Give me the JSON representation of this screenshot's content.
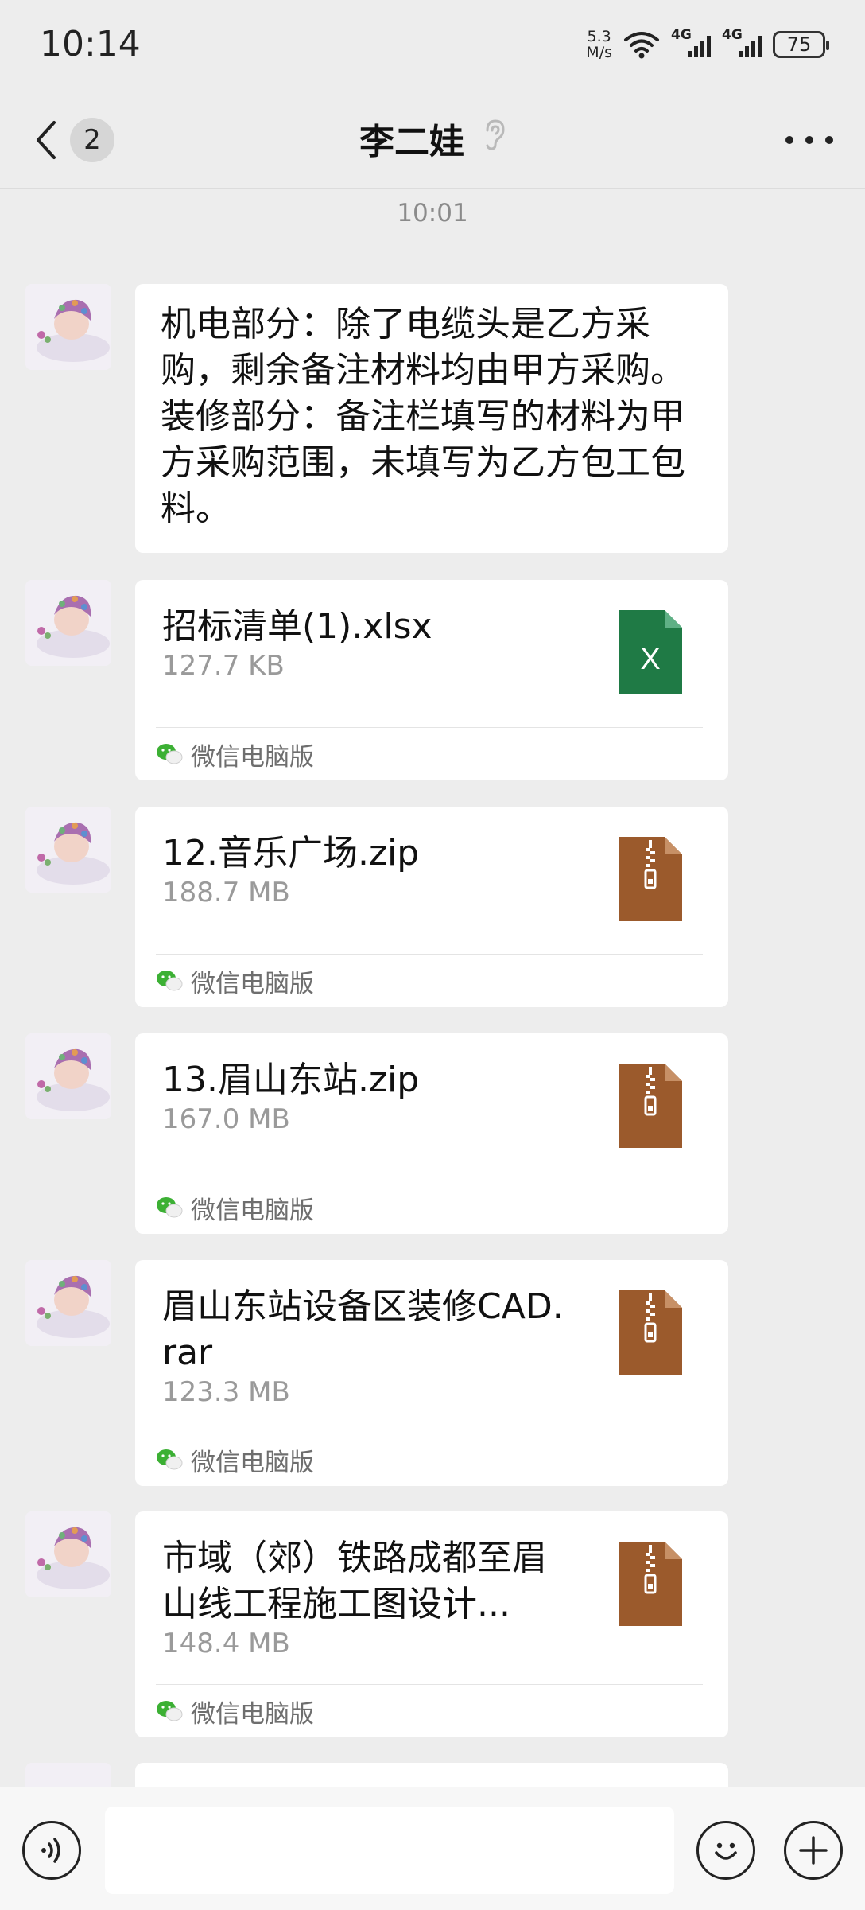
{
  "status_bar": {
    "time": "10:14",
    "speed_value": "5.3",
    "speed_unit": "M/s",
    "signal1": "4G",
    "signal2": "4G",
    "battery": "75"
  },
  "header": {
    "unread_count": "2",
    "title": "李二娃",
    "ear_icon": "ear-icon",
    "more_icon": "more-icon"
  },
  "chat": {
    "timestamp": "10:01",
    "text_message": {
      "lines": [
        "机电部分：除了电缆头是乙方采购，剩余备注材料均由甲方采购。",
        "装修部分：备注栏填写的材料为甲方采购范围，未填写为乙方包工包料。"
      ]
    },
    "files": [
      {
        "name": "招标清单(1).xlsx",
        "size": "127.7 KB",
        "icon": "excel-file-icon",
        "icon_letter": "X",
        "source": "微信电脑版",
        "color": "#1f7a45"
      },
      {
        "name": "12.音乐广场.zip",
        "size": "188.7 MB",
        "icon": "zip-file-icon",
        "source": "微信电脑版",
        "color": "#9b5a2c"
      },
      {
        "name": "13.眉山东站.zip",
        "size": "167.0 MB",
        "icon": "zip-file-icon",
        "source": "微信电脑版",
        "color": "#9b5a2c"
      },
      {
        "name": "眉山东站设备区装修CAD.rar",
        "size": "123.3 MB",
        "icon": "rar-file-icon",
        "source": "微信电脑版",
        "color": "#9b5a2c"
      },
      {
        "name": "市域（郊）铁路成都至眉山线工程施工图设计...",
        "size": "148.4 MB",
        "icon": "zip-file-icon",
        "source": "微信电脑版",
        "color": "#9b5a2c"
      }
    ]
  },
  "input_bar": {
    "voice_icon": "voice-icon",
    "emoji_icon": "emoji-icon",
    "plus_icon": "plus-icon",
    "input_value": ""
  }
}
